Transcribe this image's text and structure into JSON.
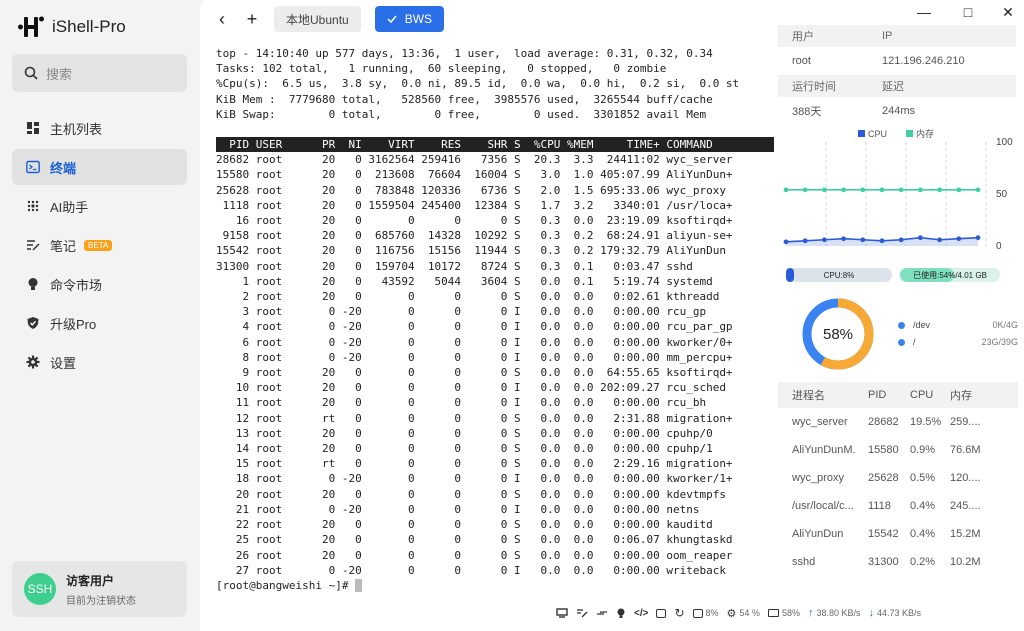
{
  "app": {
    "title": "iShell-Pro"
  },
  "search": {
    "placeholder": "搜索"
  },
  "sidebar": {
    "items": [
      {
        "label": "主机列表",
        "icon": "grid-icon"
      },
      {
        "label": "终端",
        "icon": "terminal-icon",
        "active": true
      },
      {
        "label": "AI助手",
        "icon": "ai-icon"
      },
      {
        "label": "笔记",
        "icon": "note-icon",
        "badge": "BETA"
      },
      {
        "label": "命令市场",
        "icon": "bulb-icon"
      },
      {
        "label": "升级Pro",
        "icon": "shield-icon"
      },
      {
        "label": "设置",
        "icon": "gear-icon"
      }
    ],
    "user": {
      "avatar": "SSH",
      "name": "访客用户",
      "status": "目前为注销状态"
    }
  },
  "tabs": [
    {
      "label": "本地Ubuntu",
      "active": false
    },
    {
      "label": "BWS",
      "active": true
    }
  ],
  "terminal": {
    "summary": [
      "top - 14:10:40 up 577 days, 13:36,  1 user,  load average: 0.31, 0.32, 0.34",
      "Tasks: 102 total,   1 running,  60 sleeping,   0 stopped,   0 zombie",
      "%Cpu(s):  6.5 us,  3.8 sy,  0.0 ni, 89.5 id,  0.0 wa,  0.0 hi,  0.2 si,  0.0 st",
      "KiB Mem :  7779680 total,   528560 free,  3985576 used,  3265544 buff/cache",
      "KiB Swap:        0 total,        0 free,        0 used.  3301852 avail Mem"
    ],
    "header": "  PID USER      PR  NI    VIRT    RES    SHR S  %CPU %MEM     TIME+ COMMAND    ",
    "processes": [
      "28682 root      20   0 3162564 259416   7356 S  20.3  3.3  24411:02 wyc_server",
      "15580 root      20   0  213608  76604  16004 S   3.0  1.0 405:07.99 AliYunDun+",
      "25628 root      20   0  783848 120336   6736 S   2.0  1.5 695:33.06 wyc_proxy",
      " 1118 root      20   0 1559504 245400  12384 S   1.7  3.2   3340:01 /usr/loca+",
      "   16 root      20   0       0      0      0 S   0.3  0.0  23:19.09 ksoftirqd+",
      " 9158 root      20   0  685760  14328  10292 S   0.3  0.2  68:24.91 aliyun-se+",
      "15542 root      20   0  116756  15156  11944 S   0.3  0.2 179:32.79 AliYunDun",
      "31300 root      20   0  159704  10172   8724 S   0.3  0.1   0:03.47 sshd",
      "    1 root      20   0   43592   5044   3604 S   0.0  0.1   5:19.74 systemd",
      "    2 root      20   0       0      0      0 S   0.0  0.0   0:02.61 kthreadd",
      "    3 root       0 -20       0      0      0 I   0.0  0.0   0:00.00 rcu_gp",
      "    4 root       0 -20       0      0      0 I   0.0  0.0   0:00.00 rcu_par_gp",
      "    6 root       0 -20       0      0      0 I   0.0  0.0   0:00.00 kworker/0+",
      "    8 root       0 -20       0      0      0 I   0.0  0.0   0:00.00 mm_percpu+",
      "    9 root      20   0       0      0      0 S   0.0  0.0  64:55.65 ksoftirqd+",
      "   10 root      20   0       0      0      0 I   0.0  0.0 202:09.27 rcu_sched",
      "   11 root      20   0       0      0      0 I   0.0  0.0   0:00.00 rcu_bh",
      "   12 root      rt   0       0      0      0 S   0.0  0.0   2:31.88 migration+",
      "   13 root      20   0       0      0      0 S   0.0  0.0   0:00.00 cpuhp/0",
      "   14 root      20   0       0      0      0 S   0.0  0.0   0:00.00 cpuhp/1",
      "   15 root      rt   0       0      0      0 S   0.0  0.0   2:29.16 migration+",
      "   18 root       0 -20       0      0      0 I   0.0  0.0   0:00.00 kworker/1+",
      "   20 root      20   0       0      0      0 S   0.0  0.0   0:00.00 kdevtmpfs",
      "   21 root       0 -20       0      0      0 I   0.0  0.0   0:00.00 netns",
      "   22 root      20   0       0      0      0 S   0.0  0.0   0:00.00 kauditd",
      "   25 root      20   0       0      0      0 S   0.0  0.0   0:06.07 khungtaskd",
      "   26 root      20   0       0      0      0 S   0.0  0.0   0:00.00 oom_reaper",
      "   27 root       0 -20       0      0      0 I   0.0  0.0   0:00.00 writeback"
    ],
    "prompt": "[root@bangweishi ~]# "
  },
  "info": {
    "user_label": "用户",
    "ip_label": "IP",
    "user": "root",
    "ip": "121.196.246.210",
    "uptime_label": "运行时间",
    "latency_label": "延迟",
    "uptime": "388天",
    "latency": "244ms"
  },
  "monitor": {
    "legend": [
      {
        "name": "CPU",
        "color": "#2a5bd7"
      },
      {
        "name": "内存",
        "color": "#3ecfa8"
      }
    ],
    "ticks": [
      "100",
      "50",
      "0"
    ],
    "cpu_series": [
      4,
      5,
      6,
      7,
      6,
      5,
      6,
      8,
      6,
      7,
      8
    ],
    "mem_series": [
      54,
      54,
      54,
      54,
      54,
      54,
      54,
      54,
      54,
      54,
      54
    ],
    "cpu_bar": "CPU:8%",
    "mem_bar": "已使用:54%/4.01 GB",
    "cpu_pct": 8,
    "mem_pct": 54,
    "disk_pct": 58,
    "disk_pct_label": "58%",
    "disks": [
      {
        "name": "/dev",
        "value": "0K/4G"
      },
      {
        "name": "/",
        "value": "23G/39G"
      }
    ]
  },
  "proc_table": {
    "headers": [
      "进程名",
      "PID",
      "CPU",
      "内存"
    ],
    "rows": [
      [
        "wyc_server",
        "28682",
        "19.5%",
        "259...."
      ],
      [
        "AliYunDunM...",
        "15580",
        "0.9%",
        "76.6M"
      ],
      [
        "wyc_proxy",
        "25628",
        "0.5%",
        "120...."
      ],
      [
        "/usr/local/c...",
        "1118",
        "0.4%",
        "245...."
      ],
      [
        "AliYunDun",
        "15542",
        "0.4%",
        "15.2M"
      ],
      [
        "sshd",
        "31300",
        "0.2%",
        "10.2M"
      ]
    ]
  },
  "statusbar": {
    "cpu": "8%",
    "mem": "54 %",
    "disk": "58%",
    "up": "38.80 KB/s",
    "down": "44.73 KB/s"
  }
}
